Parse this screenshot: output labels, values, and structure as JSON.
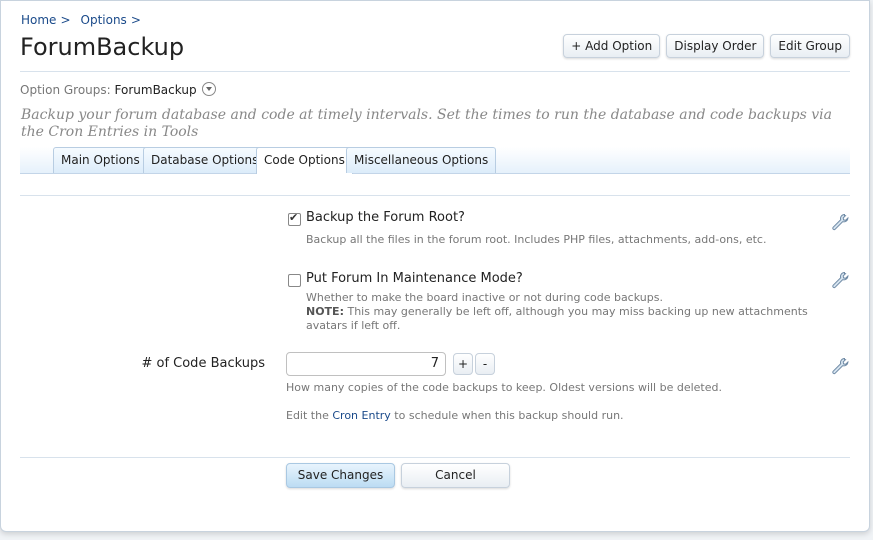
{
  "breadcrumb": {
    "items": [
      "Home",
      "Options"
    ],
    "sep": ">"
  },
  "page": {
    "title": "ForumBackup"
  },
  "top_actions": {
    "add": "+ Add Option",
    "display_order": "Display Order",
    "edit_group": "Edit Group"
  },
  "option_groups": {
    "label": "Option Groups:",
    "value": "ForumBackup"
  },
  "description": "Backup your forum database and code at timely intervals. Set the times to run the database and code backups via the Cron Entries in Tools",
  "tabs": [
    {
      "label": "Main Options",
      "active": false
    },
    {
      "label": "Database Options",
      "active": false
    },
    {
      "label": "Code Options",
      "active": true
    },
    {
      "label": "Miscellaneous Options",
      "active": false
    }
  ],
  "options": {
    "backup_root": {
      "label": "Backup the Forum Root?",
      "checked": true,
      "hint": "Backup all the files in the forum root. Includes PHP files, attachments, add-ons, etc."
    },
    "maintenance": {
      "label": "Put Forum In Maintenance Mode?",
      "checked": false,
      "hint": "Whether to make the board inactive or not during code backups.",
      "note_label": "NOTE:",
      "note_text": "This may generally be left off, although you may miss backing up new attachments avatars if left off."
    },
    "code_backups": {
      "label": "# of Code Backups",
      "value": "7",
      "plus": "+",
      "minus": "-",
      "hint": "How many copies of the code backups to keep. Oldest versions will be deleted."
    }
  },
  "cron": {
    "prefix": "Edit the",
    "link": "Cron Entry",
    "suffix": "to schedule when this backup should run."
  },
  "buttons": {
    "save": "Save Changes",
    "cancel": "Cancel"
  },
  "colors": {
    "link": "#1a4a8a",
    "accent_blue": "#bcdcf3"
  },
  "icons": {
    "edit": "wrench-icon",
    "dropdown": "chevron-down-circle-icon"
  }
}
